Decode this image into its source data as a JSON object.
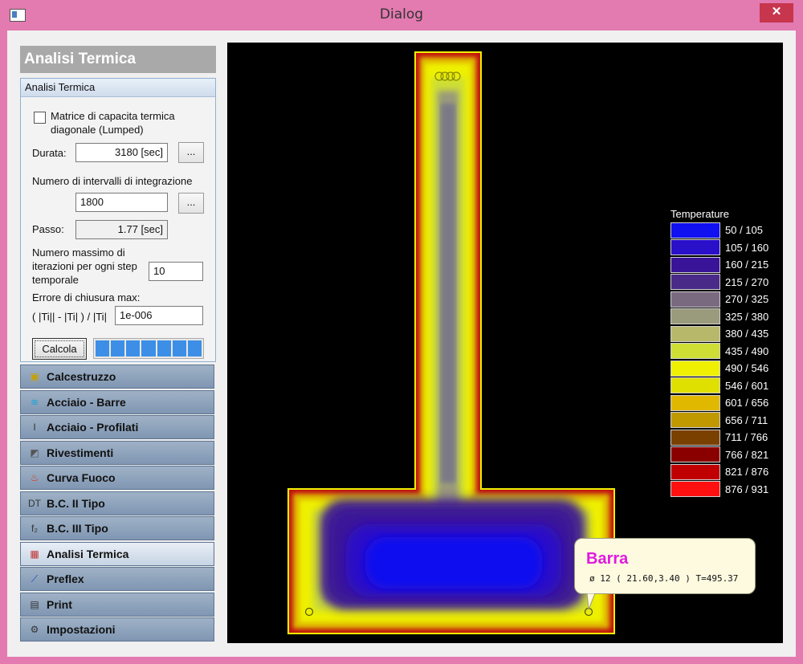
{
  "window": {
    "title": "Dialog",
    "close_label": "✕"
  },
  "panel": {
    "title": "Analisi Termica"
  },
  "group": {
    "header": "Analisi Termica",
    "lumped_label_1": "Matrice di capacita termica",
    "lumped_label_2": "diagonale (Lumped)",
    "durata_label": "Durata:",
    "durata_value": "3180 [sec]",
    "dots": "...",
    "intervalli_label": "Numero di intervalli di integrazione",
    "intervalli_value": "1800",
    "passo_label": "Passo:",
    "passo_value": "1.77 [sec]",
    "iter_label_1": "Numero massimo di",
    "iter_label_2": "iterazioni per ogni step",
    "iter_label_3": "temporale",
    "iter_value": "10",
    "errore_label": "Errore di chiusura max:",
    "errore_formula": "( |Ti|| - |Ti| ) / |Ti|",
    "errore_value": "1e-006",
    "calcola": "Calcola"
  },
  "nav": [
    {
      "label": "Calcestruzzo",
      "icon": "concrete-icon",
      "glyph": "▣",
      "color": "#c8a000",
      "active": false
    },
    {
      "label": "Acciaio - Barre",
      "icon": "rebar-icon",
      "glyph": "≋",
      "color": "#1aa0d8",
      "active": false
    },
    {
      "label": "Acciaio - Profilati",
      "icon": "i-beam-icon",
      "glyph": "I",
      "color": "#333333",
      "active": false
    },
    {
      "label": "Rivestimenti",
      "icon": "coating-icon",
      "glyph": "◩",
      "color": "#555555",
      "active": false
    },
    {
      "label": "Curva Fuoco",
      "icon": "fire-icon",
      "glyph": "♨",
      "color": "#e03a10",
      "active": false
    },
    {
      "label": "B.C. II Tipo",
      "icon": "bc2-icon",
      "glyph": "DT",
      "color": "#333333",
      "active": false
    },
    {
      "label": "B.C. III Tipo",
      "icon": "bc3-icon",
      "glyph": "f₂",
      "color": "#333333",
      "active": false
    },
    {
      "label": "Analisi Termica",
      "icon": "thermal-analysis-icon",
      "glyph": "▦",
      "color": "#c03030",
      "active": true
    },
    {
      "label": "Preflex",
      "icon": "preflex-icon",
      "glyph": "⟋",
      "color": "#2040c0",
      "active": false
    },
    {
      "label": "Print",
      "icon": "print-icon",
      "glyph": "▤",
      "color": "#333333",
      "active": false
    },
    {
      "label": "Impostazioni",
      "icon": "settings-icon",
      "glyph": "⚙",
      "color": "#333333",
      "active": false
    }
  ],
  "legend": {
    "title": "Temperature",
    "items": [
      {
        "label": "50 / 105",
        "color": "#1010f0"
      },
      {
        "label": "105 / 160",
        "color": "#2a10c8"
      },
      {
        "label": "160 / 215",
        "color": "#3a1498"
      },
      {
        "label": "215 / 270",
        "color": "#4a2a88"
      },
      {
        "label": "270 / 325",
        "color": "#7a6a80"
      },
      {
        "label": "325 / 380",
        "color": "#9a9a7c"
      },
      {
        "label": "380 / 435",
        "color": "#b8b86a"
      },
      {
        "label": "435 / 490",
        "color": "#cede34"
      },
      {
        "label": "490 / 546",
        "color": "#eef000"
      },
      {
        "label": "546 / 601",
        "color": "#e0e000"
      },
      {
        "label": "601 / 656",
        "color": "#e0b800"
      },
      {
        "label": "656 / 711",
        "color": "#c09800"
      },
      {
        "label": "711 / 766",
        "color": "#7a4000"
      },
      {
        "label": "766 / 821",
        "color": "#8a0000"
      },
      {
        "label": "821 / 876",
        "color": "#c00000"
      },
      {
        "label": "876 / 931",
        "color": "#ff1010"
      }
    ]
  },
  "tooltip": {
    "title": "Barra",
    "detail": "ø 12 ( 21.60,3.40 ) T=495.37"
  },
  "colors": {
    "outer_edge": "#cc1010",
    "bg": "#000000"
  }
}
